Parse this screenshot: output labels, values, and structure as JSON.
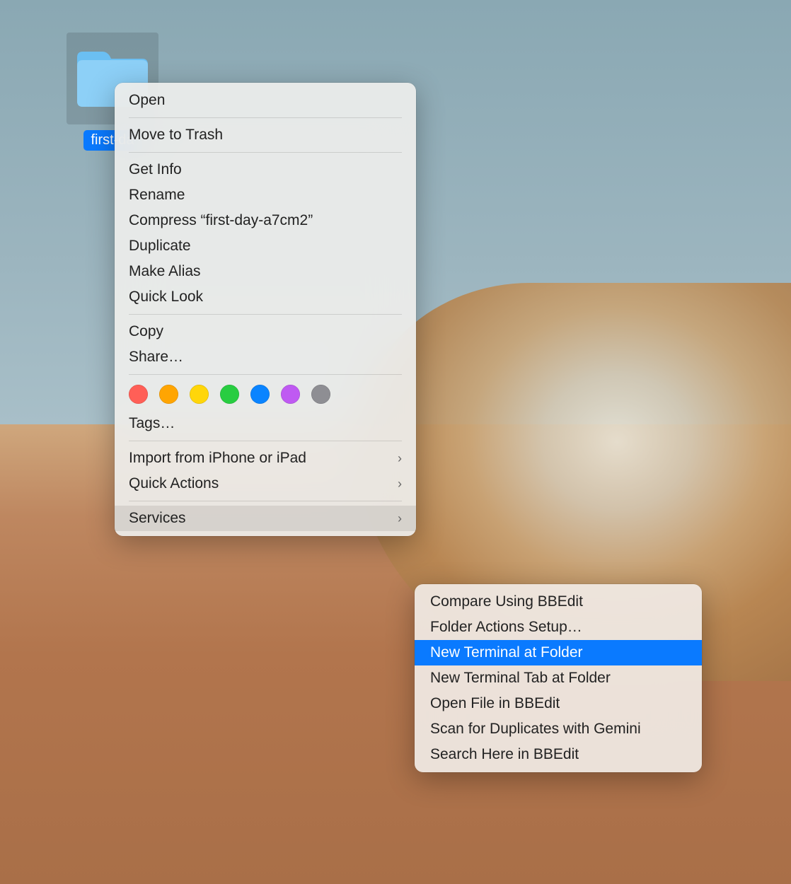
{
  "folder": {
    "label": "first-da"
  },
  "contextMenu": {
    "open": "Open",
    "moveToTrash": "Move to Trash",
    "getInfo": "Get Info",
    "rename": "Rename",
    "compress": "Compress “first-day-a7cm2”",
    "duplicate": "Duplicate",
    "makeAlias": "Make Alias",
    "quickLook": "Quick Look",
    "copy": "Copy",
    "share": "Share…",
    "tags": "Tags…",
    "importFromDevice": "Import from iPhone or iPad",
    "quickActions": "Quick Actions",
    "services": "Services"
  },
  "tagColors": [
    "#ff5f57",
    "#ffa502",
    "#ffd60a",
    "#28cd41",
    "#0a84ff",
    "#bf5af2",
    "#8e8e93"
  ],
  "submenu": {
    "compareBBEdit": "Compare Using BBEdit",
    "folderActions": "Folder Actions Setup…",
    "newTerminal": "New Terminal at Folder",
    "newTerminalTab": "New Terminal Tab at Folder",
    "openFileBBEdit": "Open File in BBEdit",
    "scanDuplicates": "Scan for Duplicates with Gemini",
    "searchBBEdit": "Search Here in BBEdit"
  }
}
